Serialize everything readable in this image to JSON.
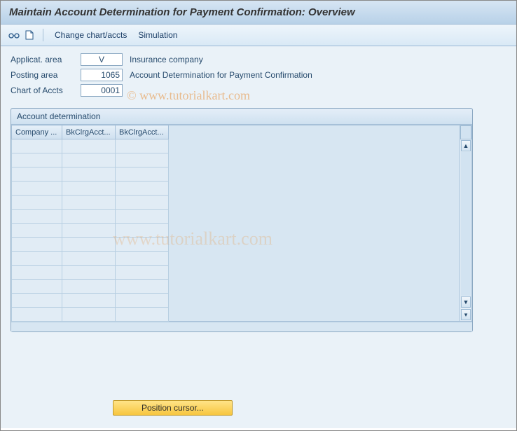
{
  "title": "Maintain Account Determination for Payment Confirmation: Overview",
  "toolbar": {
    "change_chart": "Change chart/accts",
    "simulation": "Simulation"
  },
  "form": {
    "applicat_area_label": "Applicat. area",
    "applicat_area_value": "V",
    "applicat_area_desc": "Insurance company",
    "posting_area_label": "Posting area",
    "posting_area_value": "1065",
    "posting_area_desc": "Account Determination for Payment Confirmation",
    "chart_accts_label": "Chart of Accts",
    "chart_accts_value": "0001"
  },
  "panel": {
    "title": "Account determination",
    "columns": {
      "c1": "Company ...",
      "c2": "BkClrgAcct...",
      "c3": "BkClrgAcct..."
    }
  },
  "button": {
    "position_cursor": "Position cursor..."
  },
  "watermark": {
    "small": "© www.tutorialkart.com",
    "big": "www.tutorialkart.com"
  }
}
